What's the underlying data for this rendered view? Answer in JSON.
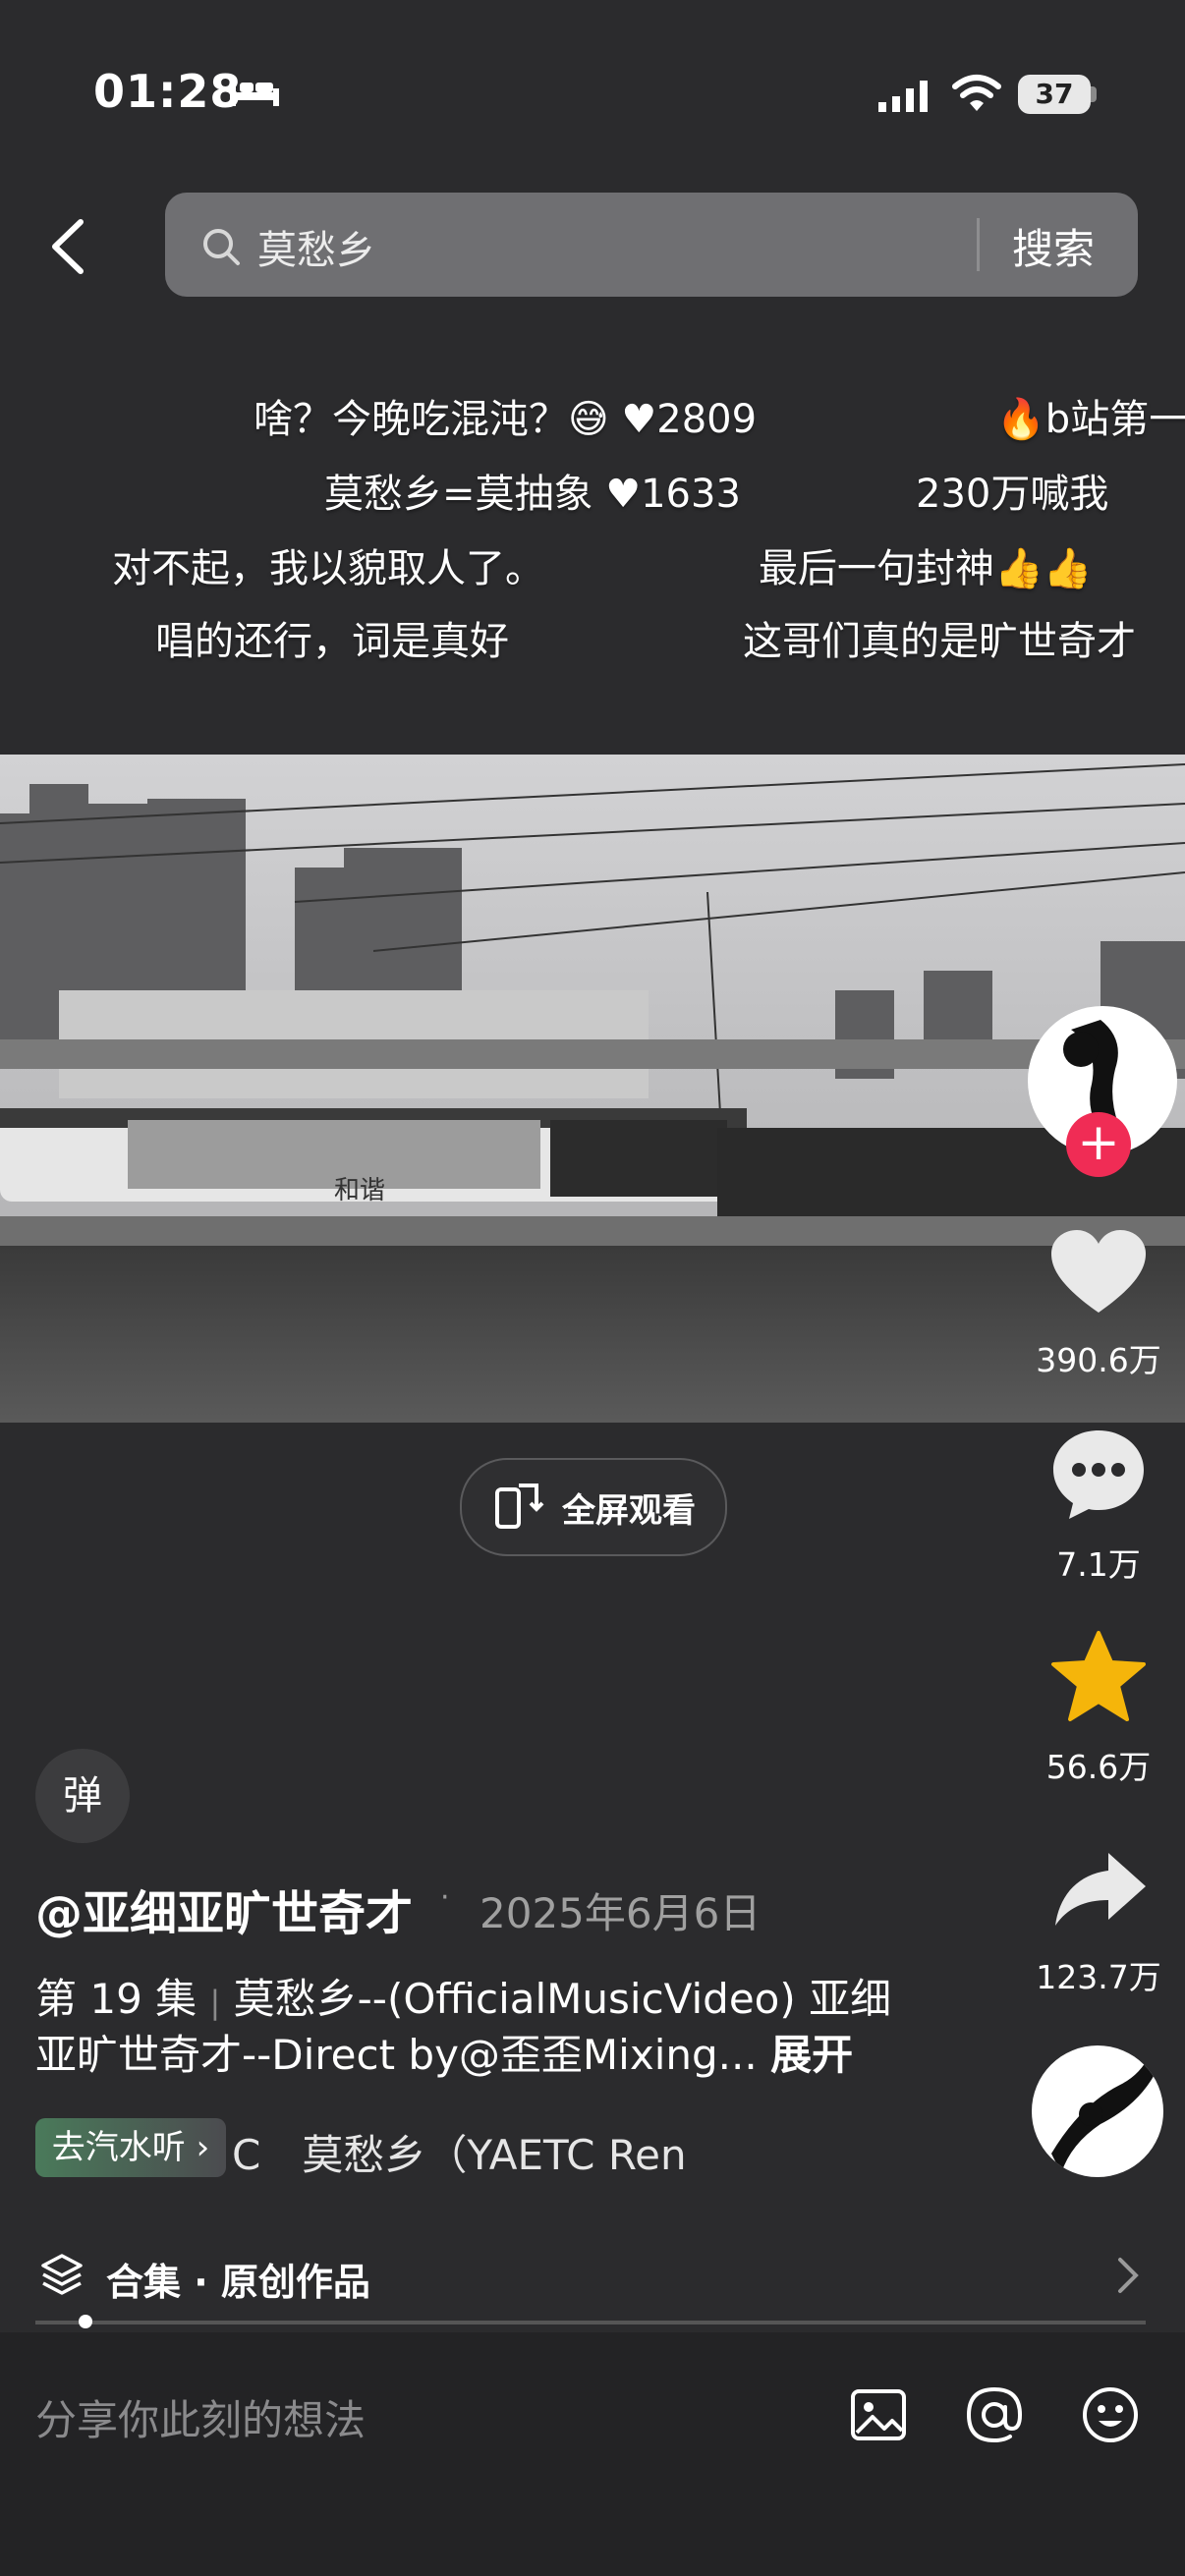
{
  "status_bar": {
    "time": "01:28",
    "battery": "37"
  },
  "search": {
    "query": "莫愁乡",
    "button_label": "搜索"
  },
  "danmaku": [
    {
      "text": "啥？今晚吃混沌？😅",
      "likes": "2809"
    },
    {
      "text": "🔥b站第一"
    },
    {
      "text": "莫愁乡=莫抽象",
      "likes": "1633"
    },
    {
      "text": "230万喊我"
    },
    {
      "text": "对不起，我以貌取人了。"
    },
    {
      "text": "最后一句封神👍👍"
    },
    {
      "text": "唱的还行，词是真好"
    },
    {
      "text": "这哥们真的是旷世奇才"
    }
  ],
  "video": {
    "fullscreen_label": "全屏观看"
  },
  "right_rail": {
    "likes": "390.6万",
    "comments": "7.1万",
    "favorites": "56.6万",
    "shares": "123.7万"
  },
  "info": {
    "danmu_toggle": "弹",
    "author": "@亚细亚旷世奇才",
    "date": "2025年6月6日",
    "episode": "第 19 集",
    "description_line1": "莫愁乡--(OfficialMusicVideo) 亚细",
    "description_line2": "亚旷世奇才--Direct by@歪歪Mixing...",
    "expand_label": "展开",
    "listen_badge": "去汽水听",
    "music_title": "C　莫愁乡（YAETC Ren",
    "collection_label": "合集 · 原创作品"
  },
  "comment_bar": {
    "placeholder": "分享你此刻的想法"
  },
  "colors": {
    "follow": "#f02c55",
    "favorite_star": "#f5b50a",
    "background": "#2b2b2d"
  }
}
